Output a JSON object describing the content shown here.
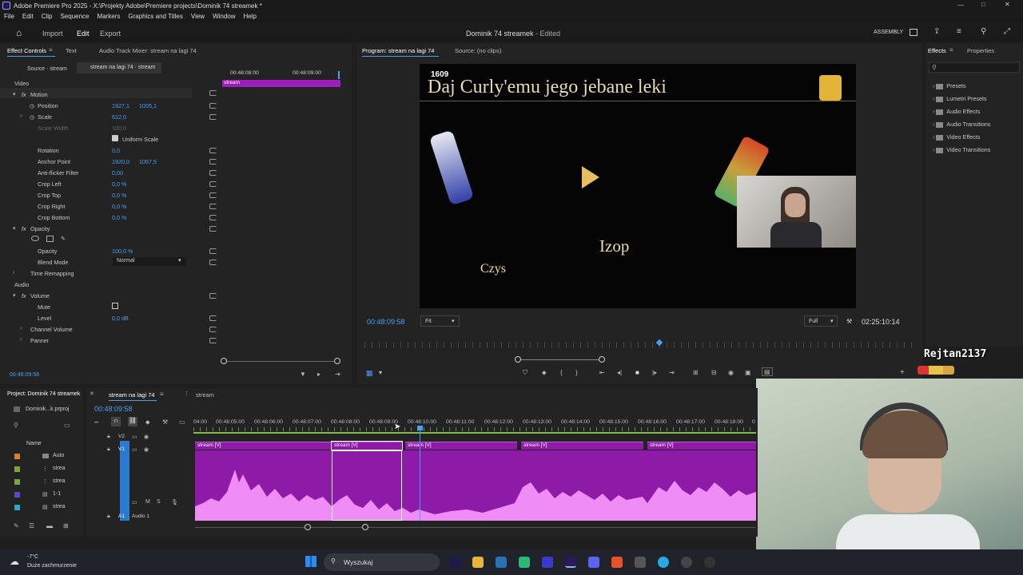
{
  "window": {
    "title": "Adobe Premiere Pro 2025 - X:\\Projekty Adobe\\Premiere projects\\Dominik 74 streamek *"
  },
  "menu": [
    "File",
    "Edit",
    "Clip",
    "Sequence",
    "Markers",
    "Graphics and Titles",
    "View",
    "Window",
    "Help"
  ],
  "header": {
    "import": "Import",
    "edit": "Edit",
    "export": "Export",
    "project_title": "Dominik 74 streamek",
    "status": "- Edited",
    "workspace": "ASSEMBLY"
  },
  "effect_controls": {
    "tabs": [
      "Effect Controls",
      "Text",
      "Audio Track Mixer: stream na lagi 74"
    ],
    "source": "Source · stream",
    "sequence": "stream na lagi 74 · stream",
    "mini_ruler": [
      "00:48:08:00",
      "00:48:09:00"
    ],
    "clip_name": "stream",
    "video": "Video",
    "motion": "Motion",
    "position": {
      "label": "Position",
      "x": "1927,1",
      "y": "1005,1"
    },
    "scale": {
      "label": "Scale",
      "v": "612,0"
    },
    "scale_width": {
      "label": "Scale Width",
      "v": "100,0"
    },
    "uniform": "Uniform Scale",
    "rotation": {
      "label": "Rotation",
      "v": "0,0"
    },
    "anchor": {
      "label": "Anchor Point",
      "x": "1920,0",
      "y": "1067,5"
    },
    "antiflicker": {
      "label": "Anti-flicker Filter",
      "v": "0,00"
    },
    "crop_left": {
      "label": "Crop Left",
      "v": "0,0 %"
    },
    "crop_top": {
      "label": "Crop Top",
      "v": "0,0 %"
    },
    "crop_right": {
      "label": "Crop Right",
      "v": "0,0 %"
    },
    "crop_bottom": {
      "label": "Crop Bottom",
      "v": "0,0 %"
    },
    "opacity_group": "Opacity",
    "opacity": {
      "label": "Opacity",
      "v": "100,0 %"
    },
    "blend": {
      "label": "Blend Mode",
      "v": "Normal"
    },
    "time_remap": "Time Remapping",
    "audio": "Audio",
    "volume": "Volume",
    "mute": "Mute",
    "level": {
      "label": "Level",
      "v": "0,0 dB"
    },
    "channel_volume": "Channel Volume",
    "panner": "Panner",
    "timecode": "00:48:09:58"
  },
  "program": {
    "tab": "Program: stream na lagi 74",
    "source_tab": "Source: (no clips)",
    "counter": "1609",
    "caption": "Daj Curly'emu jego jebane leki",
    "word1": "Izop",
    "word2": "Czys",
    "timecode": "00:48:09:58",
    "fit": "Fit",
    "quality": "Full",
    "duration": "02:25:10:14",
    "overlay_name": "Rejtan2137"
  },
  "effects": {
    "tabs": [
      "Effects",
      "Properties"
    ],
    "items": [
      "Presets",
      "Lumetri Presets",
      "Audio Effects",
      "Audio Transitions",
      "Video Effects",
      "Video Transitions"
    ]
  },
  "project": {
    "tab": "Project: Dominik 74 streamek",
    "file": "Dominik...k.prproj",
    "name_col": "Name",
    "items": [
      "Auto",
      "strea",
      "strea",
      "1-1",
      "strea"
    ]
  },
  "timeline": {
    "tabs": [
      "stream na lagi 74",
      "stream"
    ],
    "timecode": "00:48:09:58",
    "ruler": [
      "04:00",
      "00:48:05:00",
      "00:48:06:00",
      "00:48:07:00",
      "00:48:08:00",
      "00:48:09:00",
      "00:48:10:00",
      "00:48:11:00",
      "00:48:12:00",
      "00:48:13:00",
      "00:48:14:00",
      "00:48:15:00",
      "00:48:16:00",
      "00:48:17:00",
      "00:48:18:00",
      "0"
    ],
    "tracks": {
      "v2": "V2",
      "v1": "V1",
      "a1": "A1",
      "audio1": "Audio 1"
    },
    "clip_label": "stream [V]"
  },
  "taskbar": {
    "temp": "-7°C",
    "weather": "Duże zachmurzenie",
    "search": "Wyszukaj"
  },
  "colors": {
    "accent": "#4a9ff5",
    "clip": "#8e1aa8",
    "wave": "#f08cf5",
    "label_purple": "#9b1fb8"
  }
}
